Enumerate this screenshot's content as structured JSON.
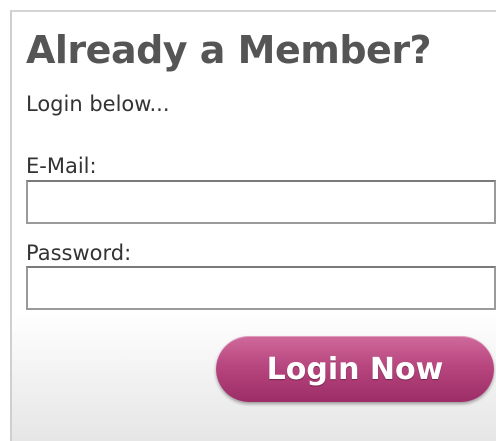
{
  "login": {
    "title": "Already a Member?",
    "subtitle": "Login below...",
    "email_label": "E-Mail:",
    "email_value": "",
    "password_label": "Password:",
    "password_value": "",
    "submit_label": "Login Now"
  },
  "colors": {
    "title": "#555555",
    "button_top": "#cf6a9b",
    "button_bottom": "#9c2d66"
  }
}
